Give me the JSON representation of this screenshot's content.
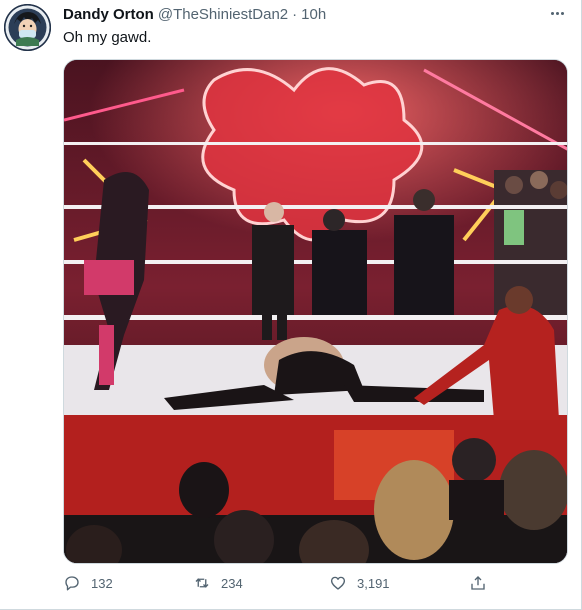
{
  "tweet": {
    "display_name": "Dandy Orton",
    "handle": "@TheShiniestDan2",
    "separator": "·",
    "timestamp": "10h",
    "text": "Oh my gawd.",
    "media_alt": "wrestling ring photo"
  },
  "actions": {
    "reply_count": "132",
    "retweet_count": "234",
    "like_count": "3,191"
  },
  "colors": {
    "text_primary": "#0f1419",
    "text_secondary": "#536471",
    "border": "#cfd9de"
  }
}
